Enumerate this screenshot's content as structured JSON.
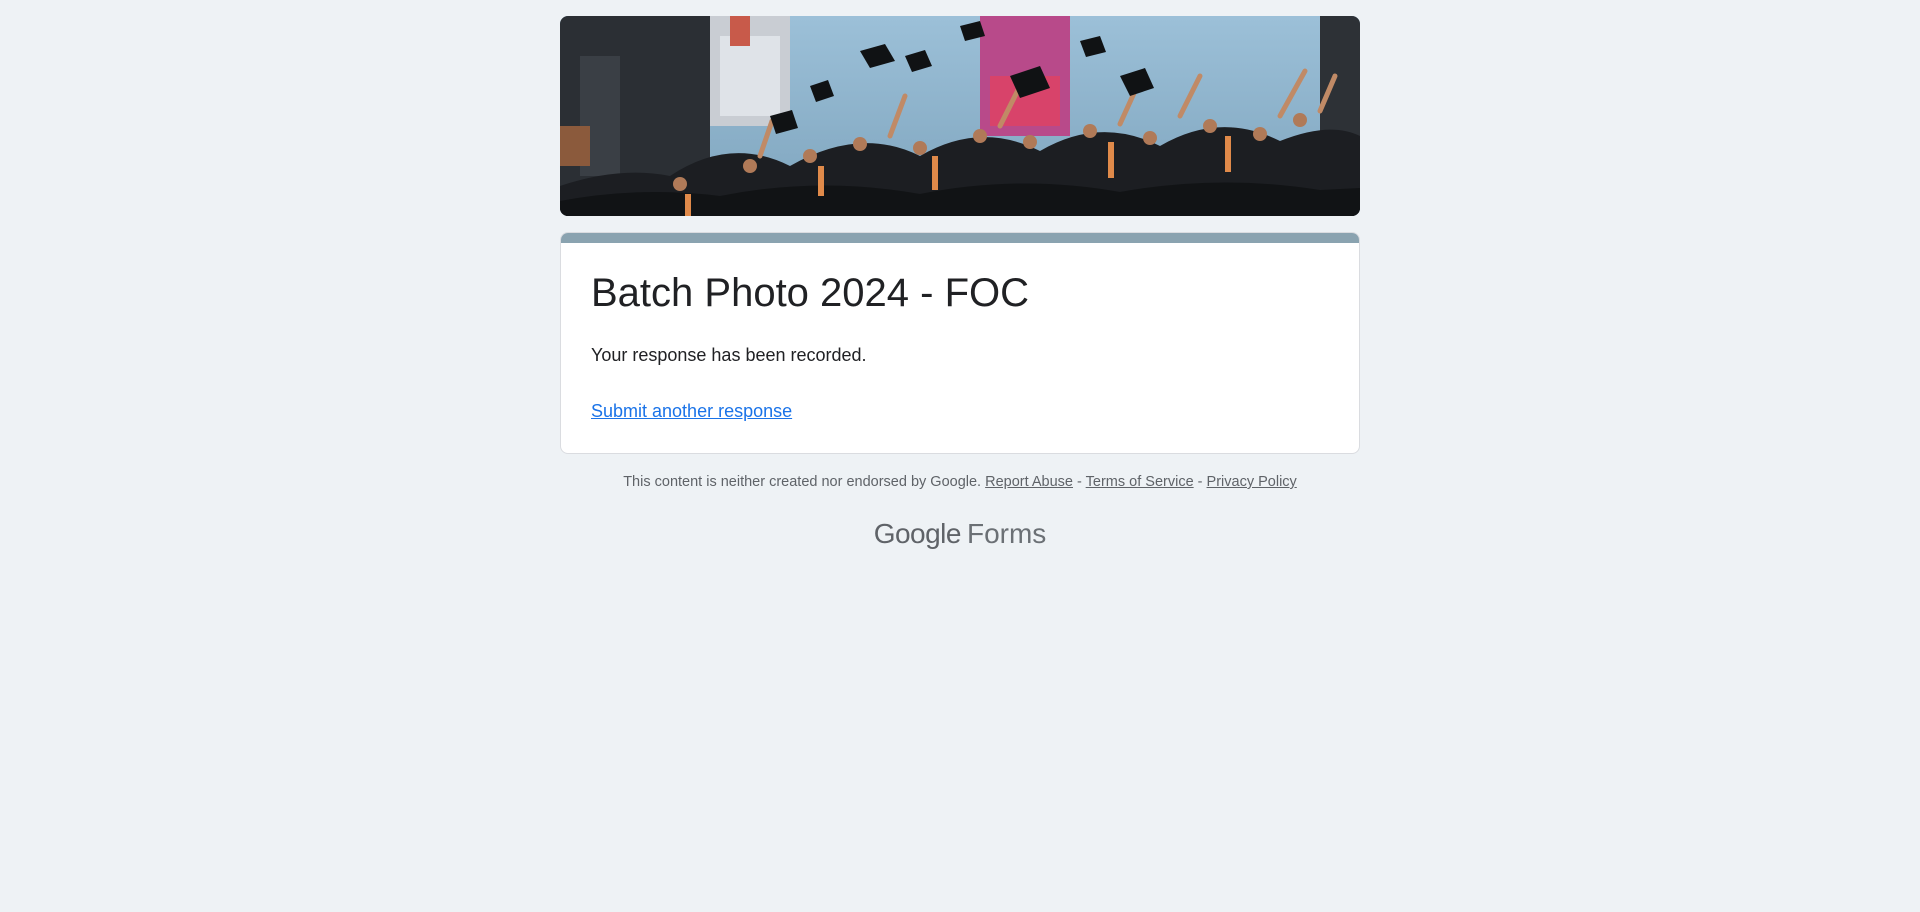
{
  "form": {
    "title": "Batch Photo 2024 - FOC",
    "confirmation_message": "Your response has been recorded.",
    "submit_another_label": "Submit another response"
  },
  "footer": {
    "disclaimer": "This content is neither created nor endorsed by Google.",
    "report_abuse": "Report Abuse",
    "separator": "-",
    "terms_of_service": "Terms of Service",
    "privacy_policy": "Privacy Policy"
  },
  "brand": {
    "google": "Google",
    "forms": "Forms"
  },
  "colors": {
    "background": "#eef2f5",
    "accent_bar": "#8aa3b0",
    "link": "#1a73e8"
  },
  "banner": {
    "icon": "graduation-banner-image"
  }
}
